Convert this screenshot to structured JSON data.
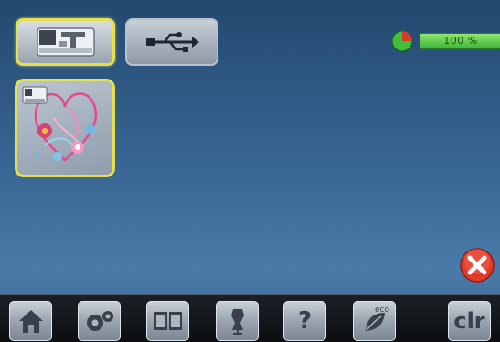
{
  "source_tabs": [
    {
      "icon": "embroidery-machine-icon",
      "selected": true
    },
    {
      "icon": "usb-icon",
      "selected": false
    }
  ],
  "memory": {
    "label": "100 %",
    "fill_fraction": 1.0,
    "pie_icon": "memory-pie-icon",
    "colors": {
      "pie_used": "#d83a2a",
      "pie_free": "#3fbf3a",
      "bar": "#5ccf48"
    }
  },
  "design_list": [
    {
      "icon": "machine-memory-design-thumbnail",
      "selected": true
    }
  ],
  "actions": {
    "close_icon": "close-icon",
    "close_color": "#e23a2a"
  },
  "bottom_bar": {
    "buttons": [
      {
        "id": "home",
        "icon": "home-icon"
      },
      {
        "id": "setup",
        "icon": "gears-icon"
      },
      {
        "id": "tutorial",
        "icon": "book-icon"
      },
      {
        "id": "consultant",
        "icon": "dress-form-icon"
      },
      {
        "id": "help",
        "icon": "question-icon",
        "label": "?"
      },
      {
        "id": "eco",
        "icon": "eco-leaf-icon",
        "label": "eco"
      },
      {
        "id": "clear",
        "icon": "clr-icon",
        "label": "clr"
      }
    ]
  },
  "colors": {
    "accent_yellow": "#e6e14a",
    "screen_top": "#22486e",
    "screen_bottom": "#4a7aa8"
  }
}
